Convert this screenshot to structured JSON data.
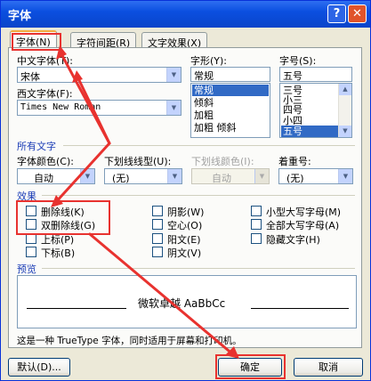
{
  "window": {
    "title": "字体",
    "help_label": "?",
    "close_label": "✕"
  },
  "tabs": [
    {
      "label": "字体(N)"
    },
    {
      "label": "字符间距(R)"
    },
    {
      "label": "文字效果(X)"
    }
  ],
  "font": {
    "chinese_font_label": "中文字体(T):",
    "chinese_font_value": "宋体",
    "western_font_label": "西文字体(F):",
    "western_font_value": "Times New Roman",
    "style_label": "字形(Y):",
    "style_value": "常规",
    "style_items": [
      "常规",
      "倾斜",
      "加粗",
      "加粗 倾斜"
    ],
    "style_selected": "常规",
    "size_label": "字号(S):",
    "size_value": "五号",
    "size_items": [
      "三号",
      "小三",
      "四号",
      "小四",
      "五号"
    ],
    "size_selected": "五号"
  },
  "all_text": {
    "section": "所有文字",
    "color_label": "字体颜色(C):",
    "color_value": "自动",
    "underline_label": "下划线线型(U):",
    "underline_value": "(无)",
    "underline_color_label": "下划线颜色(I):",
    "underline_color_value": "自动",
    "emphasis_label": "着重号:",
    "emphasis_value": "(无)"
  },
  "effects": {
    "section": "效果",
    "col1": [
      "删除线(K)",
      "双删除线(G)",
      "上标(P)",
      "下标(B)"
    ],
    "col2": [
      "阴影(W)",
      "空心(O)",
      "阳文(E)",
      "阴文(V)"
    ],
    "col3": [
      "小型大写字母(M)",
      "全部大写字母(A)",
      "隐藏文字(H)"
    ]
  },
  "preview": {
    "section": "预览",
    "sample": "微软卓越 AaBbCc"
  },
  "footer_note": "这是一种 TrueType 字体，同时适用于屏幕和打印机。",
  "buttons": {
    "default_label": "默认(D)...",
    "ok_label": "确定",
    "cancel_label": "取消"
  },
  "colors": {
    "highlight": "#e8322f",
    "title_bar": "#0b4fe0",
    "dialog_bg": "#ece9d8",
    "selection": "#316ac5"
  }
}
